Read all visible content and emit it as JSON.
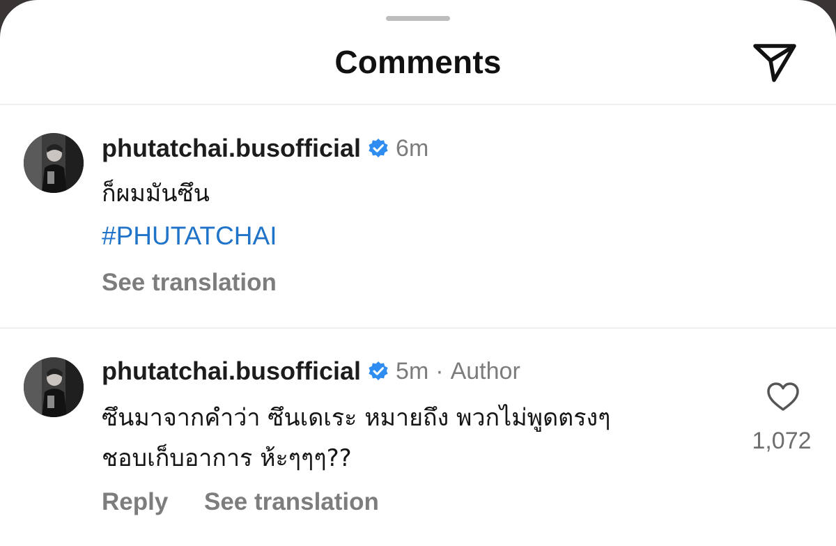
{
  "header": {
    "title": "Comments"
  },
  "comments": [
    {
      "username": "phutatchai.busofficial",
      "time": "6m",
      "text": "ก็ผมมันซึน",
      "hashtag": "#PHUTATCHAI",
      "see_translation": "See translation"
    },
    {
      "username": "phutatchai.busofficial",
      "time": "5m",
      "separator": "·",
      "author_label": "Author",
      "lines": [
        "ซึนมาจากคำว่า ซึนเดเระ หมายถึง พวกไม่พูดตรงๆ",
        "ชอบเก็บอาการ ห้ะๆๆๆ??"
      ],
      "reply": "Reply",
      "see_translation": "See translation",
      "likes": "1,072"
    }
  ],
  "colors": {
    "hashtag": "#1f73c8",
    "verified_badge": "#2f8cf0",
    "muted_text": "#7c7c7c"
  },
  "icons": {
    "share": "paper-plane-icon",
    "verified": "verified-badge-icon",
    "like": "heart-outline-icon"
  }
}
